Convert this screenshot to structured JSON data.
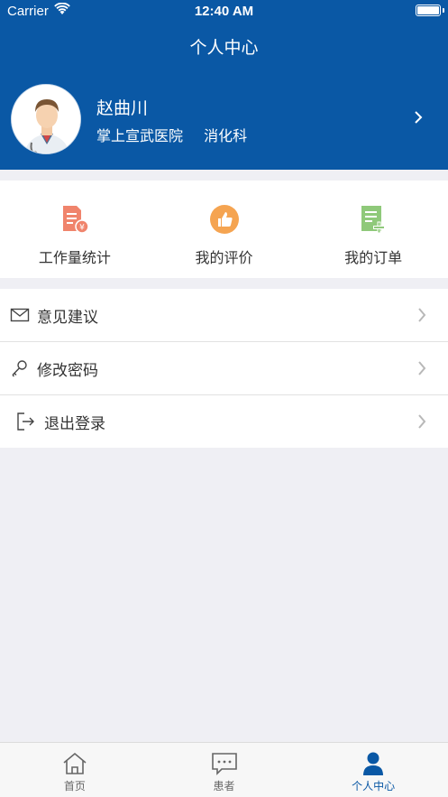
{
  "status_bar": {
    "carrier": "Carrier",
    "time": "12:40 AM"
  },
  "nav": {
    "title": "个人中心"
  },
  "profile": {
    "name": "赵曲川",
    "hospital": "掌上宣武医院",
    "department": "消化科"
  },
  "quick_actions": [
    {
      "label": "工作量统计",
      "icon": "workload-stats-icon",
      "color": "#f0846c"
    },
    {
      "label": "我的评价",
      "icon": "thumbs-up-icon",
      "color": "#f5a451"
    },
    {
      "label": "我的订单",
      "icon": "order-list-icon",
      "color": "#8fc97a"
    }
  ],
  "menu": [
    {
      "label": "意见建议",
      "icon": "mail-icon"
    },
    {
      "label": "修改密码",
      "icon": "key-icon"
    },
    {
      "label": "退出登录",
      "icon": "logout-icon"
    }
  ],
  "tabs": [
    {
      "label": "首页",
      "icon": "home-icon",
      "active": false
    },
    {
      "label": "患者",
      "icon": "chat-icon",
      "active": false
    },
    {
      "label": "个人中心",
      "icon": "person-icon",
      "active": true
    }
  ],
  "colors": {
    "primary": "#0a58a5",
    "background": "#efeff4"
  }
}
